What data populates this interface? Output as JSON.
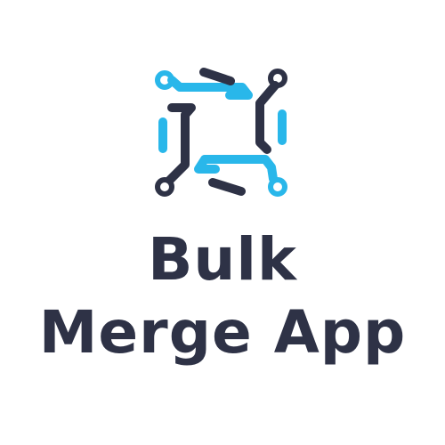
{
  "logo": {
    "icon": "bulk-merge-logo-icon",
    "colors": {
      "accent": "#29b7ea",
      "dark": "#2e3246",
      "background": "#ffffff"
    }
  },
  "wordmark": {
    "line1": "Bulk",
    "line2": "Merge App"
  }
}
